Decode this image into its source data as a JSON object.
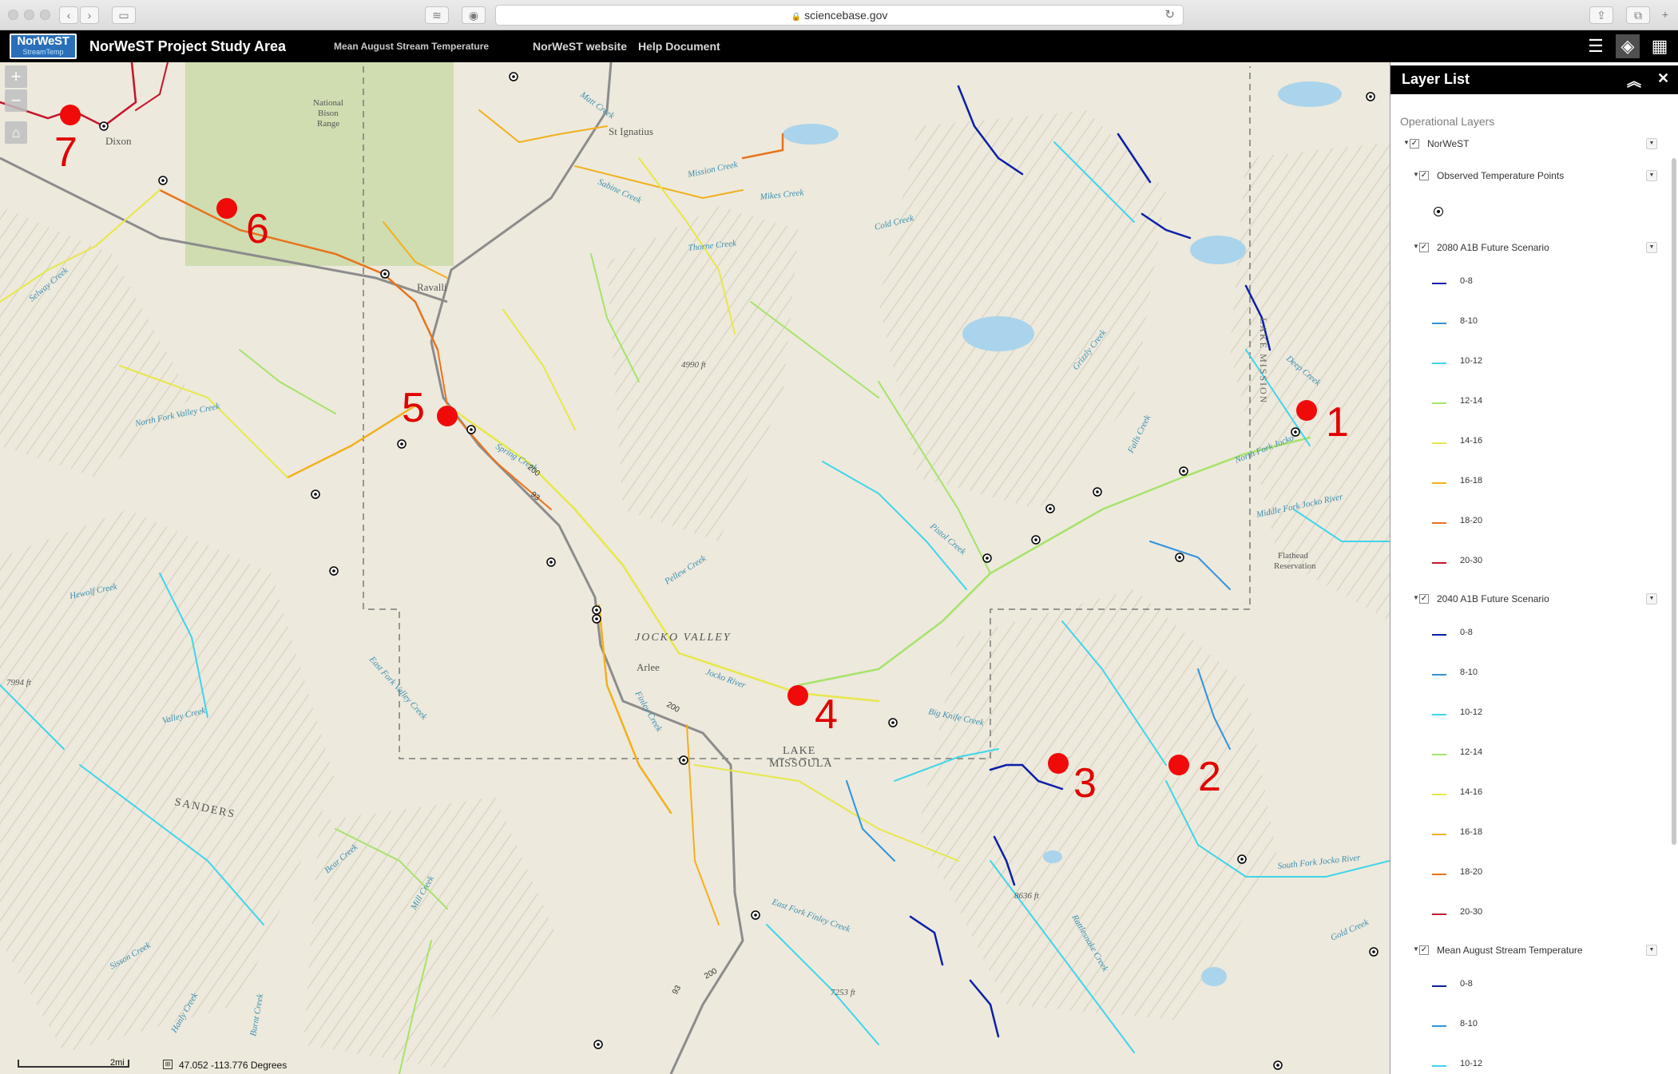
{
  "browser": {
    "url": "sciencebase.gov",
    "nav_back": "‹",
    "nav_forward": "›"
  },
  "header": {
    "logo_line1": "NorWeST",
    "logo_line2": "StreamTemp",
    "title": "NorWeST Project Study Area",
    "subtitle": "Mean August Stream Temperature",
    "links": [
      "NorWeST website",
      "Help Document"
    ],
    "icons": [
      "list-icon",
      "layers-icon",
      "grid-icon"
    ]
  },
  "map": {
    "coordinates": "47.052  -113.776 Degrees",
    "scale_label": "2mi",
    "place_labels": [
      {
        "text": "St Ignatius"
      },
      {
        "text": "Ravalli"
      },
      {
        "text": "Dixon"
      },
      {
        "text": "JOCKO VALLEY"
      },
      {
        "text": "Arlee"
      },
      {
        "text": "LAKE"
      },
      {
        "text": "MISSOULA"
      },
      {
        "text": "SANDERS"
      },
      {
        "text": "National"
      },
      {
        "text": "Bison"
      },
      {
        "text": "Range"
      },
      {
        "text": "4990 ft"
      },
      {
        "text": "7994 ft"
      },
      {
        "text": "8636 ft"
      },
      {
        "text": "7253 ft"
      },
      {
        "text": "Flathead"
      },
      {
        "text": "Reservation"
      },
      {
        "text": "Mission Creek"
      },
      {
        "text": "Mikes Creek"
      },
      {
        "text": "Cold Creek"
      },
      {
        "text": "Thorne Creek"
      },
      {
        "text": "Sabine Creek"
      },
      {
        "text": "Pistol Creek"
      },
      {
        "text": "Jocko River"
      },
      {
        "text": "Big Knife Creek"
      },
      {
        "text": "Hewolf Creek"
      },
      {
        "text": "North Fork Valley Creek"
      },
      {
        "text": "Valley Creek"
      },
      {
        "text": "East Fork Valley Creek"
      },
      {
        "text": "Spring Creek"
      },
      {
        "text": "Pellew Creek"
      },
      {
        "text": "Finley Creek"
      },
      {
        "text": "East Fork Finley Creek"
      },
      {
        "text": "Bear Creek"
      },
      {
        "text": "Mill Creek"
      },
      {
        "text": "Sisson Creek"
      },
      {
        "text": "Falls Creek"
      },
      {
        "text": "Deep Creek"
      },
      {
        "text": "Middle Fork Jocko River"
      },
      {
        "text": "North Fork Jocko"
      },
      {
        "text": "South Fork Jocko River"
      },
      {
        "text": "Rattlesnake Creek"
      },
      {
        "text": "Gold Creek"
      },
      {
        "text": "Matt Creek"
      },
      {
        "text": "Grizzly Creek"
      },
      {
        "text": "Sabine Creek"
      },
      {
        "text": "Selway Creek"
      },
      {
        "text": "Hanly Creek"
      },
      {
        "text": "Burnt Creek"
      },
      {
        "text": "LAKE MISSION"
      },
      {
        "text": "200"
      },
      {
        "text": "93"
      },
      {
        "text": "200"
      },
      {
        "text": "93"
      },
      {
        "text": "200"
      }
    ],
    "sites": [
      {
        "label": "1"
      },
      {
        "label": "2"
      },
      {
        "label": "3"
      },
      {
        "label": "4"
      },
      {
        "label": "5"
      },
      {
        "label": "6"
      },
      {
        "label": "7"
      }
    ]
  },
  "layer_list": {
    "title": "Layer List",
    "operational_label": "Operational Layers",
    "root_layer": "NorWeST",
    "sublayers": [
      {
        "name": "Observed Temperature Points",
        "legend": []
      },
      {
        "name": "2080 A1B Future Scenario",
        "legend": [
          "0-8",
          "8-10",
          "10-12",
          "12-14",
          "14-16",
          "16-18",
          "18-20",
          "20-30"
        ]
      },
      {
        "name": "2040 A1B Future Scenario",
        "legend": [
          "0-8",
          "8-10",
          "10-12",
          "12-14",
          "14-16",
          "16-18",
          "18-20",
          "20-30"
        ]
      },
      {
        "name": "Mean August Stream Temperature",
        "legend": [
          "0-8",
          "8-10",
          "10-12"
        ]
      }
    ],
    "legend_colors": {
      "0-8": "#0a1fa8",
      "8-10": "#2f93e0",
      "10-12": "#3fd5ea",
      "12-14": "#a6e36b",
      "14-16": "#e6e84a",
      "16-18": "#f2b01e",
      "18-20": "#e8731c",
      "20-30": "#c4142b"
    }
  }
}
